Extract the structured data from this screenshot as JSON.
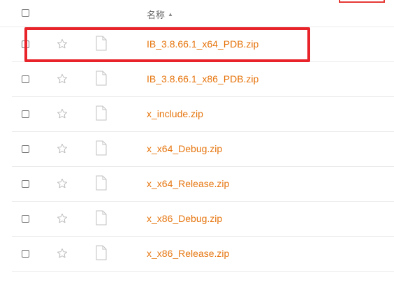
{
  "header": {
    "name_label": "名称",
    "sort_arrow": "▲"
  },
  "files": [
    {
      "name": "IB_3.8.66.1_x64_PDB.zip"
    },
    {
      "name": "IB_3.8.66.1_x86_PDB.zip"
    },
    {
      "name": "x_include.zip"
    },
    {
      "name": "x_x64_Debug.zip"
    },
    {
      "name": "x_x64_Release.zip"
    },
    {
      "name": "x_x86_Debug.zip"
    },
    {
      "name": "x_x86_Release.zip"
    }
  ],
  "icons": {
    "star": "star-outline-icon",
    "file": "generic-file-icon"
  },
  "colors": {
    "link": "#e6750e",
    "highlight": "#e8232a",
    "divider": "#ebebeb"
  }
}
